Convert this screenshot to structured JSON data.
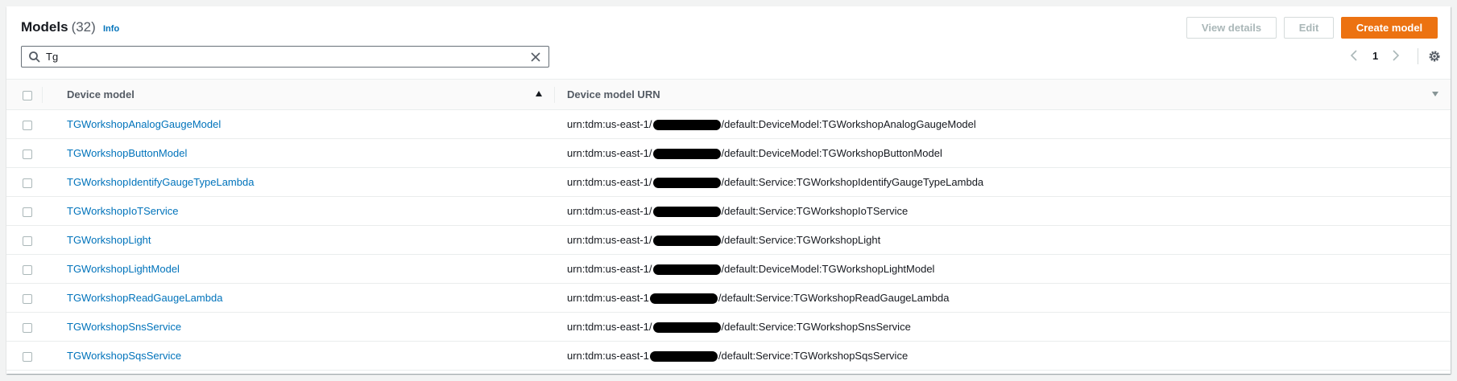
{
  "header": {
    "title": "Models",
    "count": "(32)",
    "info_label": "Info",
    "view_details_label": "View details",
    "edit_label": "Edit",
    "create_label": "Create model"
  },
  "search": {
    "value": "Tg",
    "icon": "search-icon",
    "clear_icon": "close-icon"
  },
  "pagination": {
    "prev_icon": "chevron-left-icon",
    "current_page": "1",
    "next_icon": "chevron-right-icon",
    "settings_icon": "gear-icon"
  },
  "table": {
    "columns": [
      "Device model",
      "Device model URN"
    ],
    "sort_icon": "caret-up-icon",
    "rows": [
      {
        "model": "TGWorkshopAnalogGaugeModel",
        "urn_prefix": "urn:tdm:us-east-1/",
        "urn_suffix": "/default:DeviceModel:TGWorkshopAnalogGaugeModel"
      },
      {
        "model": "TGWorkshopButtonModel",
        "urn_prefix": "urn:tdm:us-east-1/",
        "urn_suffix": "/default:DeviceModel:TGWorkshopButtonModel"
      },
      {
        "model": "TGWorkshopIdentifyGaugeTypeLambda",
        "urn_prefix": "urn:tdm:us-east-1/",
        "urn_suffix": "/default:Service:TGWorkshopIdentifyGaugeTypeLambda"
      },
      {
        "model": "TGWorkshopIoTService",
        "urn_prefix": "urn:tdm:us-east-1/",
        "urn_suffix": "/default:Service:TGWorkshopIoTService"
      },
      {
        "model": "TGWorkshopLight",
        "urn_prefix": "urn:tdm:us-east-1/",
        "urn_suffix": "/default:Service:TGWorkshopLight"
      },
      {
        "model": "TGWorkshopLightModel",
        "urn_prefix": "urn:tdm:us-east-1/",
        "urn_suffix": "/default:DeviceModel:TGWorkshopLightModel"
      },
      {
        "model": "TGWorkshopReadGaugeLambda",
        "urn_prefix": "urn:tdm:us-east-1",
        "urn_suffix": "/default:Service:TGWorkshopReadGaugeLambda"
      },
      {
        "model": "TGWorkshopSnsService",
        "urn_prefix": "urn:tdm:us-east-1/",
        "urn_suffix": "/default:Service:TGWorkshopSnsService"
      },
      {
        "model": "TGWorkshopSqsService",
        "urn_prefix": "urn:tdm:us-east-1",
        "urn_suffix": "/default:Service:TGWorkshopSqsService"
      }
    ]
  },
  "colors": {
    "link": "#0073bb",
    "primary_button": "#ec7211",
    "disabled_text": "#aab7b8"
  }
}
